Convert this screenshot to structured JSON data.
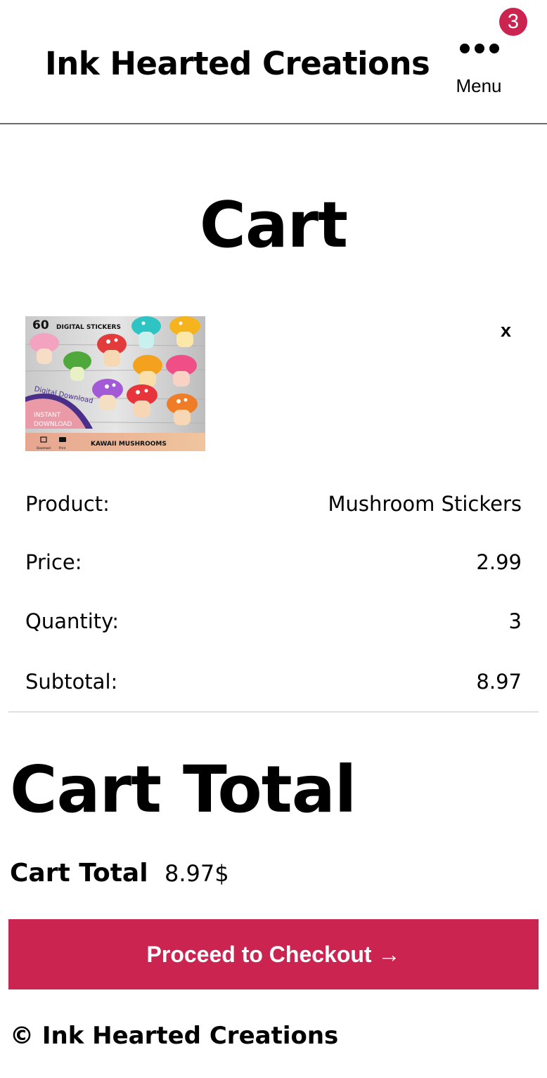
{
  "header": {
    "site_title": "Ink Hearted Creations",
    "menu_label": "Menu",
    "cart_count": "3",
    "badge_color": "#cc2450"
  },
  "page": {
    "title": "Cart"
  },
  "cart": {
    "remove_label": "x",
    "product_image": {
      "icon": "product-thumbnail",
      "count_text": "60",
      "heading_text": "DIGITAL STICKERS",
      "ribbon_text": "Digital Download",
      "instant_text_1": "INSTANT",
      "instant_text_2": "DOWNLOAD",
      "download_text": "Download",
      "print_text": "Print",
      "footer_text": "KAWAII MUSHROOMS"
    },
    "rows": [
      {
        "label": "Product:",
        "value": "Mushroom Stickers"
      },
      {
        "label": "Price:",
        "value": "2.99"
      },
      {
        "label": "Quantity:",
        "value": "3"
      },
      {
        "label": "Subtotal:",
        "value": "8.97"
      }
    ]
  },
  "totals": {
    "heading": "Cart Total",
    "label": "Cart Total",
    "value": "8.97$"
  },
  "checkout": {
    "label": "Proceed to Checkout →",
    "color": "#cc2450"
  },
  "footer": {
    "text": "© Ink Hearted Creations"
  }
}
